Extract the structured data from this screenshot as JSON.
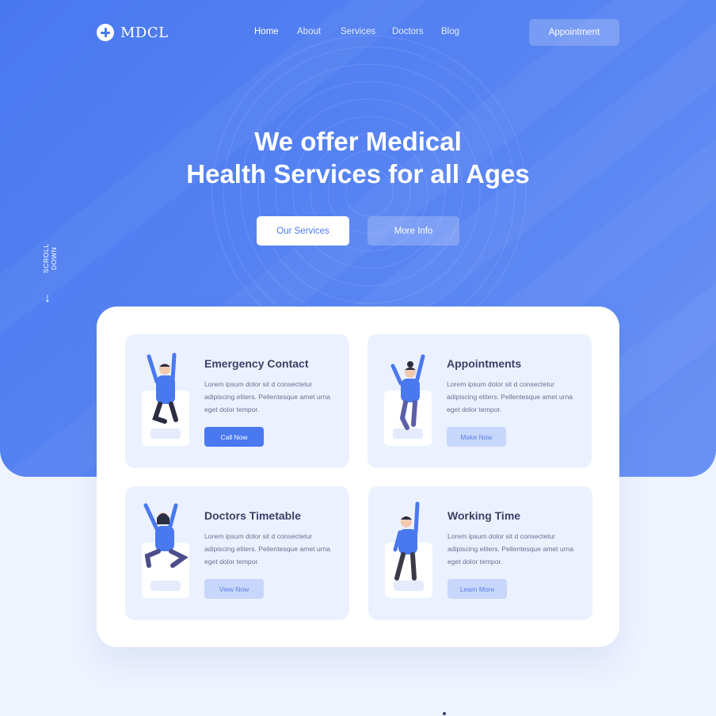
{
  "nav": {
    "brand": "MDCL",
    "items": [
      {
        "label": "Home",
        "active": true
      },
      {
        "label": "About",
        "active": false
      },
      {
        "label": "Services",
        "active": false
      },
      {
        "label": "Doctors",
        "active": false
      },
      {
        "label": "Blog",
        "active": false
      }
    ],
    "cta_label": "Appointment"
  },
  "hero": {
    "headline_line1": "We offer Medical",
    "headline_line2": "Health Services for all Ages",
    "primary_label": "Our Services",
    "secondary_label": "More Info",
    "scroll_label": "SCROLL DOWN"
  },
  "cards": [
    {
      "title": "Emergency Contact",
      "text": "Lorem ipsum dolor sit d consectetur adipiscing eliters. Pellentesque amet urna eget dolor tempor.",
      "button": "Call Now",
      "style": "primary"
    },
    {
      "title": "Appointments",
      "text": "Lorem ipsum dolor sit d consectetur adipiscing eliters. Pellentesque amet urna eget dolor tempor.",
      "button": "Make Now",
      "style": "soft"
    },
    {
      "title": "Doctors Timetable",
      "text": "Lorem ipsum dolor sit d consectetur adipiscing eliters. Pellentesque amet urna eget dolor tempor.",
      "button": "View Now",
      "style": "soft"
    },
    {
      "title": "Working Time",
      "text": "Lorem ipsum dolor sit d consectetur adipiscing eliters. Pellentesque amet urna eget dolor tempor.",
      "button": "Learn More",
      "style": "soft"
    }
  ],
  "colors": {
    "primary": "#4a78ef",
    "card_bg": "#ebf1fe",
    "heading": "#3e3f66",
    "body_text": "#6b7090",
    "soft_button": "#c7d7fb"
  }
}
